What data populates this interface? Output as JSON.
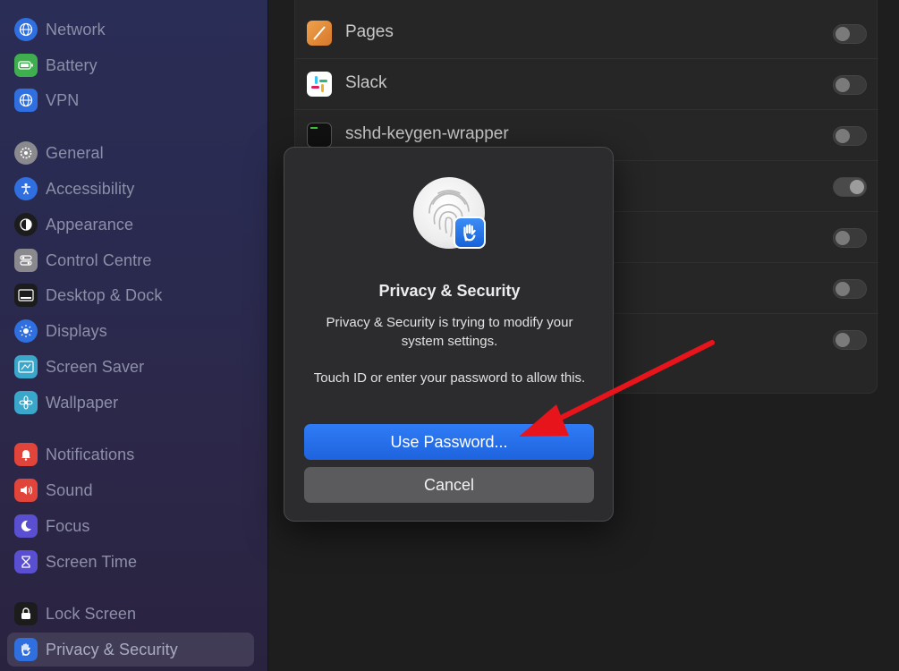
{
  "sidebar": {
    "items": [
      {
        "label": "Network",
        "icon": "globe-icon",
        "color": "#2f6fe0"
      },
      {
        "label": "Battery",
        "icon": "battery-icon",
        "color": "#3fae4f"
      },
      {
        "label": "VPN",
        "icon": "vpn-globe-icon",
        "color": "#2f6fe0"
      },
      {
        "label": "General",
        "icon": "gear-icon",
        "color": "#8a8a8e"
      },
      {
        "label": "Accessibility",
        "icon": "accessibility-icon",
        "color": "#2f6fe0"
      },
      {
        "label": "Appearance",
        "icon": "appearance-icon",
        "color": "#1c1c1c"
      },
      {
        "label": "Control Centre",
        "icon": "control-centre-icon",
        "color": "#8a8a8e"
      },
      {
        "label": "Desktop & Dock",
        "icon": "dock-icon",
        "color": "#1c1c1c"
      },
      {
        "label": "Displays",
        "icon": "sun-icon",
        "color": "#2f6fe0"
      },
      {
        "label": "Screen Saver",
        "icon": "screen-saver-icon",
        "color": "#3aa6c9"
      },
      {
        "label": "Wallpaper",
        "icon": "wallpaper-icon",
        "color": "#3aa6c9"
      },
      {
        "label": "Notifications",
        "icon": "bell-icon",
        "color": "#e0443a"
      },
      {
        "label": "Sound",
        "icon": "speaker-icon",
        "color": "#e0443a"
      },
      {
        "label": "Focus",
        "icon": "moon-icon",
        "color": "#5a4fd1"
      },
      {
        "label": "Screen Time",
        "icon": "hourglass-icon",
        "color": "#5a4fd1"
      },
      {
        "label": "Lock Screen",
        "icon": "lock-icon",
        "color": "#1c1c1c"
      },
      {
        "label": "Privacy & Security",
        "icon": "hand-icon",
        "color": "#2f6fe0"
      }
    ],
    "selected": "Privacy & Security"
  },
  "apps": {
    "rows": [
      {
        "label": "Pages",
        "icon": "pages-icon",
        "enabled": false
      },
      {
        "label": "Slack",
        "icon": "slack-icon",
        "enabled": false
      },
      {
        "label": "sshd-keygen-wrapper",
        "icon": "terminal-icon",
        "enabled": false
      },
      {
        "label": "",
        "icon": "",
        "enabled": true
      },
      {
        "label": "",
        "icon": "",
        "enabled": false
      },
      {
        "label": "",
        "icon": "",
        "enabled": false
      },
      {
        "label": "",
        "icon": "",
        "enabled": false
      }
    ]
  },
  "dialog": {
    "title": "Privacy & Security",
    "message": "Privacy & Security is trying to modify your system settings.",
    "message2": "Touch ID or enter your password to allow this.",
    "primary_label": "Use Password...",
    "secondary_label": "Cancel"
  },
  "colors": {
    "accent": "#2f7cf6",
    "annotation_arrow": "#e8141b"
  }
}
